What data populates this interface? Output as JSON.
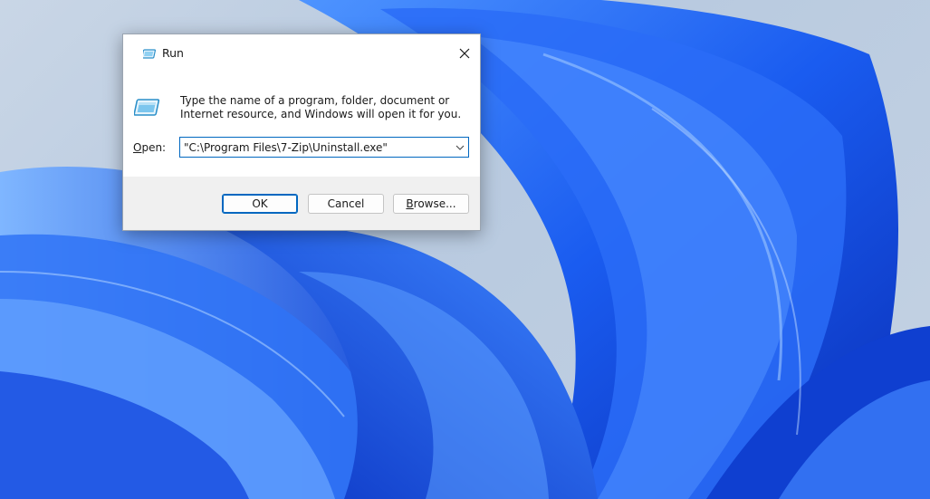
{
  "dialog": {
    "title": "Run",
    "description": "Type the name of a program, folder, document or Internet resource, and Windows will open it for you.",
    "open_label_mnemonic": "O",
    "open_label_rest": "pen:",
    "open_value": "\"C:\\Program Files\\7-Zip\\Uninstall.exe\"",
    "buttons": {
      "ok": "OK",
      "cancel": "Cancel",
      "browse_mnemonic": "B",
      "browse_rest": "rowse..."
    }
  },
  "icons": {
    "title": "run-icon",
    "big": "run-icon",
    "close": "close-icon",
    "dropdown": "chevron-down-icon"
  },
  "colors": {
    "accent": "#0067c0",
    "footer": "#f0f0f0",
    "wallpaper_blue": "#1a5cf0"
  }
}
